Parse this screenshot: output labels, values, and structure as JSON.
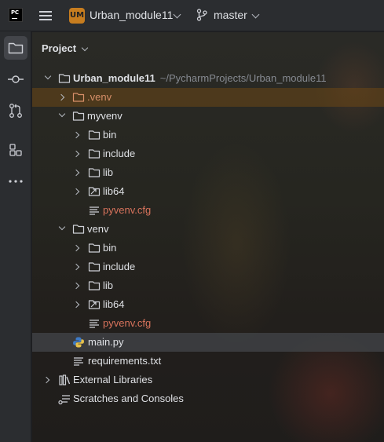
{
  "titlebar": {
    "app_logo_text": "PC",
    "project_badge": "UM",
    "project_name": "Urban_module11",
    "branch": "master"
  },
  "toolstrip": {
    "items": [
      {
        "icon": "folder-icon",
        "active": true
      },
      {
        "icon": "commit-icon",
        "active": false
      },
      {
        "icon": "pull-request-icon",
        "active": false
      },
      {
        "icon": "structure-icon",
        "active": false
      },
      {
        "icon": "more-icon",
        "active": false
      }
    ]
  },
  "panel": {
    "title": "Project"
  },
  "tree": {
    "root": {
      "label": "Urban_module11",
      "path": "~/PycharmProjects/Urban_module11"
    },
    "dot_venv": {
      "label": ".venv"
    },
    "myvenv": {
      "label": "myvenv",
      "bin": "bin",
      "include": "include",
      "lib": "lib",
      "lib64": "lib64",
      "cfg": "pyvenv.cfg"
    },
    "venv": {
      "label": "venv",
      "bin": "bin",
      "include": "include",
      "lib": "lib",
      "lib64": "lib64",
      "cfg": "pyvenv.cfg"
    },
    "main_py": "main.py",
    "requirements": "requirements.txt",
    "external_libraries": "External Libraries",
    "scratches": "Scratches and Consoles"
  }
}
